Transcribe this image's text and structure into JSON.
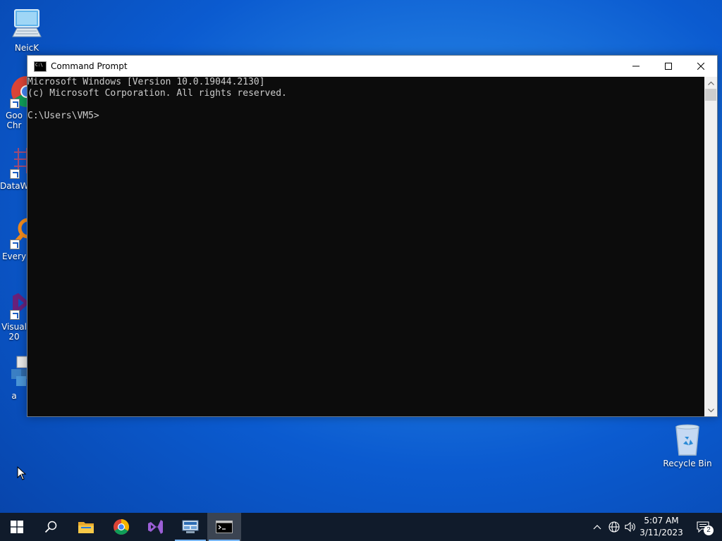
{
  "desktop": {
    "icons": [
      {
        "label": "NeicK"
      },
      {
        "label": "Goo Chr"
      },
      {
        "label": "DataW"
      },
      {
        "label": "Every"
      },
      {
        "label": "Visual 20"
      },
      {
        "label": "a"
      },
      {
        "label": "Recycle Bin"
      }
    ]
  },
  "window": {
    "title": "Command Prompt",
    "lines": [
      "Microsoft Windows [Version 10.0.19044.2130]",
      "(c) Microsoft Corporation. All rights reserved.",
      "",
      "C:\\Users\\VM5>"
    ],
    "console_bg": "#0c0c0c",
    "console_fg": "#cccccc"
  },
  "taskbar": {
    "items": [
      {
        "icon": "windows-start-icon"
      },
      {
        "icon": "search-icon"
      },
      {
        "icon": "file-explorer-icon"
      },
      {
        "icon": "chrome-icon"
      },
      {
        "icon": "visual-studio-icon"
      },
      {
        "icon": "network-app-icon"
      },
      {
        "icon": "command-prompt-icon"
      }
    ],
    "tray": {
      "time": "5:07 AM",
      "date": "3/11/2023",
      "notification_count": "2"
    },
    "bg": "#101b2b"
  }
}
